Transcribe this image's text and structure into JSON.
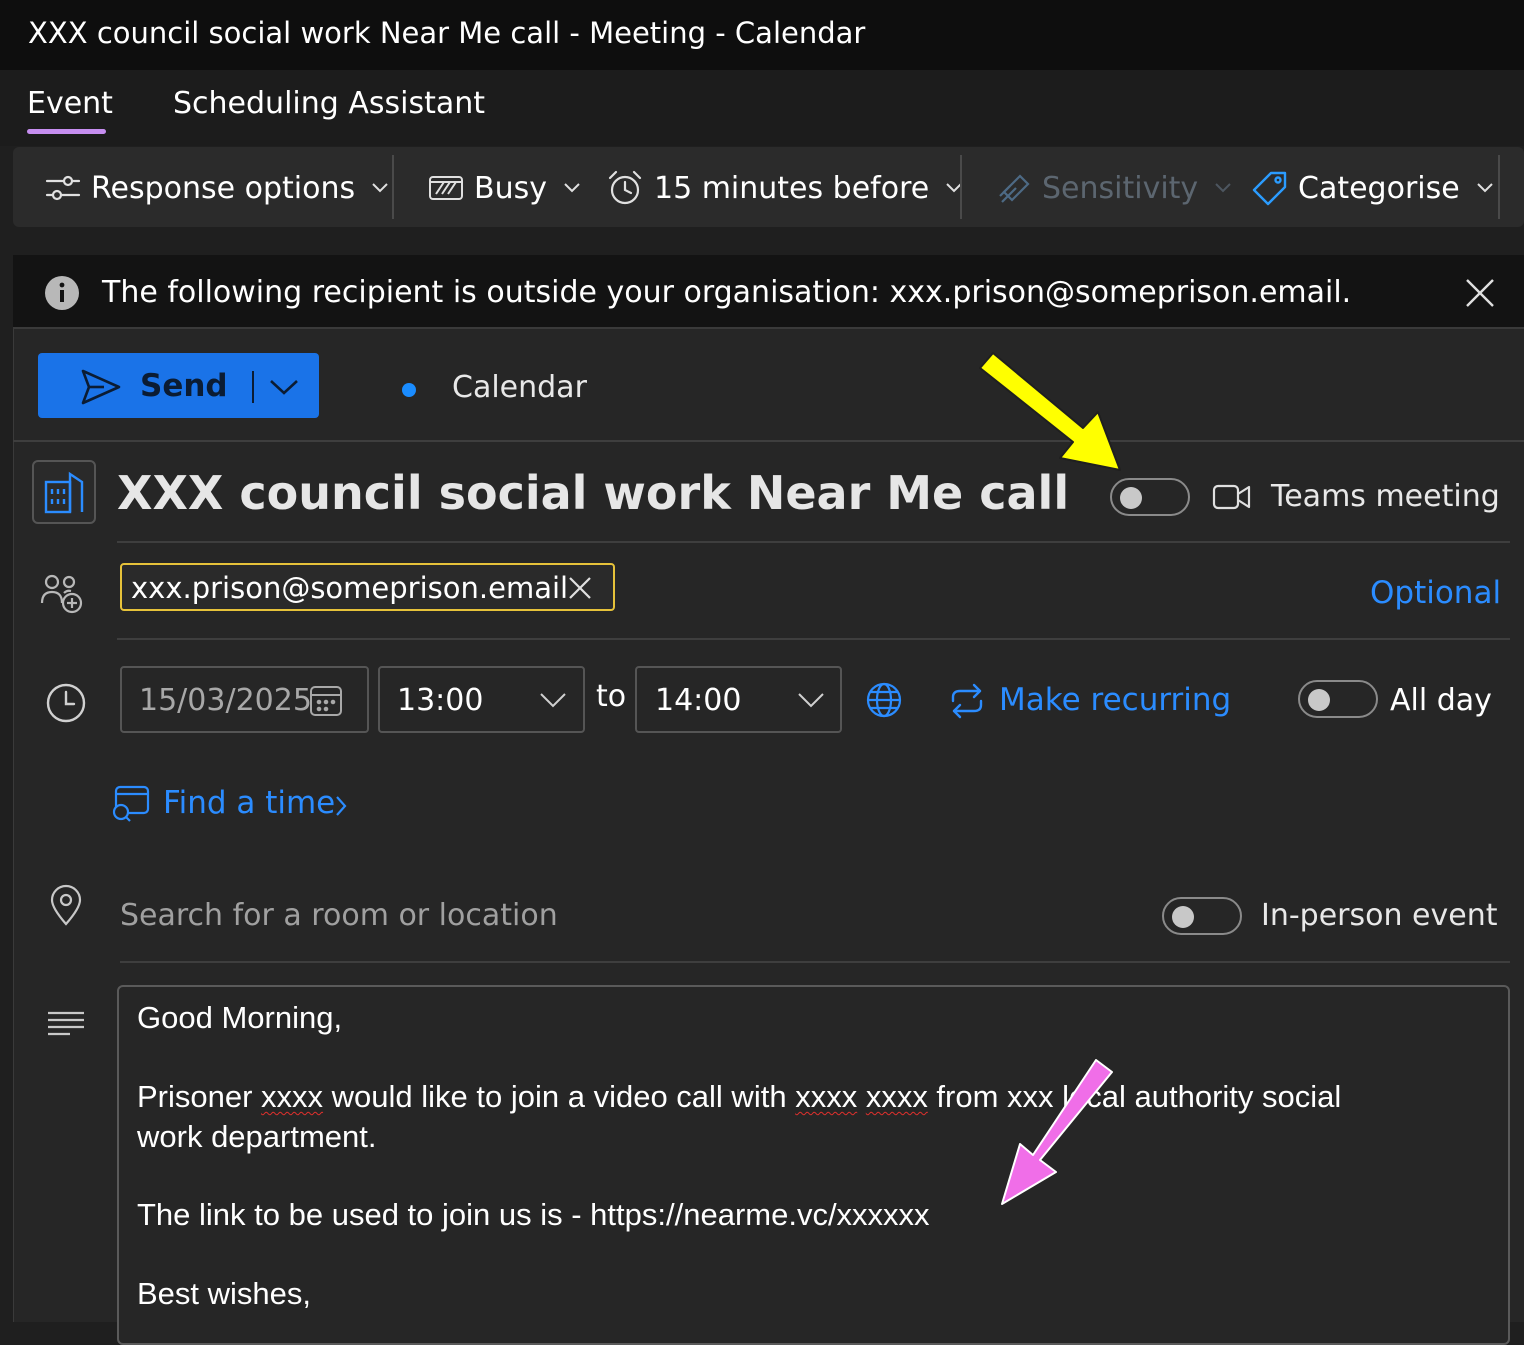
{
  "window": {
    "title": "XXX council social work Near Me call - Meeting - Calendar"
  },
  "tabs": [
    {
      "label": "Event",
      "active": true
    },
    {
      "label": "Scheduling Assistant",
      "active": false
    }
  ],
  "toolbar": {
    "response_options": "Response options",
    "busy": "Busy",
    "reminder": "15 minutes before",
    "sensitivity": "Sensitivity",
    "categorise": "Categorise"
  },
  "infobar": {
    "message": "The following recipient is outside your organisation: xxx.prison@someprison.email."
  },
  "actions": {
    "send_label": "Send",
    "calendar_label": "Calendar",
    "calendar_color": "#1a8cff",
    "send_color": "#1a73e8"
  },
  "event": {
    "subject": "XXX council social work Near Me call",
    "teams_meeting_label": "Teams meeting",
    "teams_meeting_on": false,
    "attendee": "xxx.prison@someprison.email",
    "optional_label": "Optional",
    "date": "15/03/2025",
    "start_time": "13:00",
    "to_label": "to",
    "end_time": "14:00",
    "make_recurring": "Make recurring",
    "all_day_label": "All day",
    "all_day_on": false,
    "find_time": "Find a time",
    "location_placeholder": "Search for a room or location",
    "in_person_label": "In-person event",
    "in_person_on": false
  },
  "body": {
    "greeting": "Good Morning,",
    "l1_a": "Prisoner ",
    "l1_b": "xxxx",
    "l1_c": " would like to join a video call with ",
    "l1_d": "xxxx",
    "l1_e": " ",
    "l1_f": "xxxx",
    "l1_g": " from xxx local authority social",
    "line2": "work department.",
    "link_line": "The link to be used to join us is - https://nearme.vc/xxxxxx",
    "signoff": "Best wishes,"
  },
  "annotations": {
    "yellow_arrow_color": "#ffff00",
    "pink_arrow_color": "#f06ee8"
  }
}
